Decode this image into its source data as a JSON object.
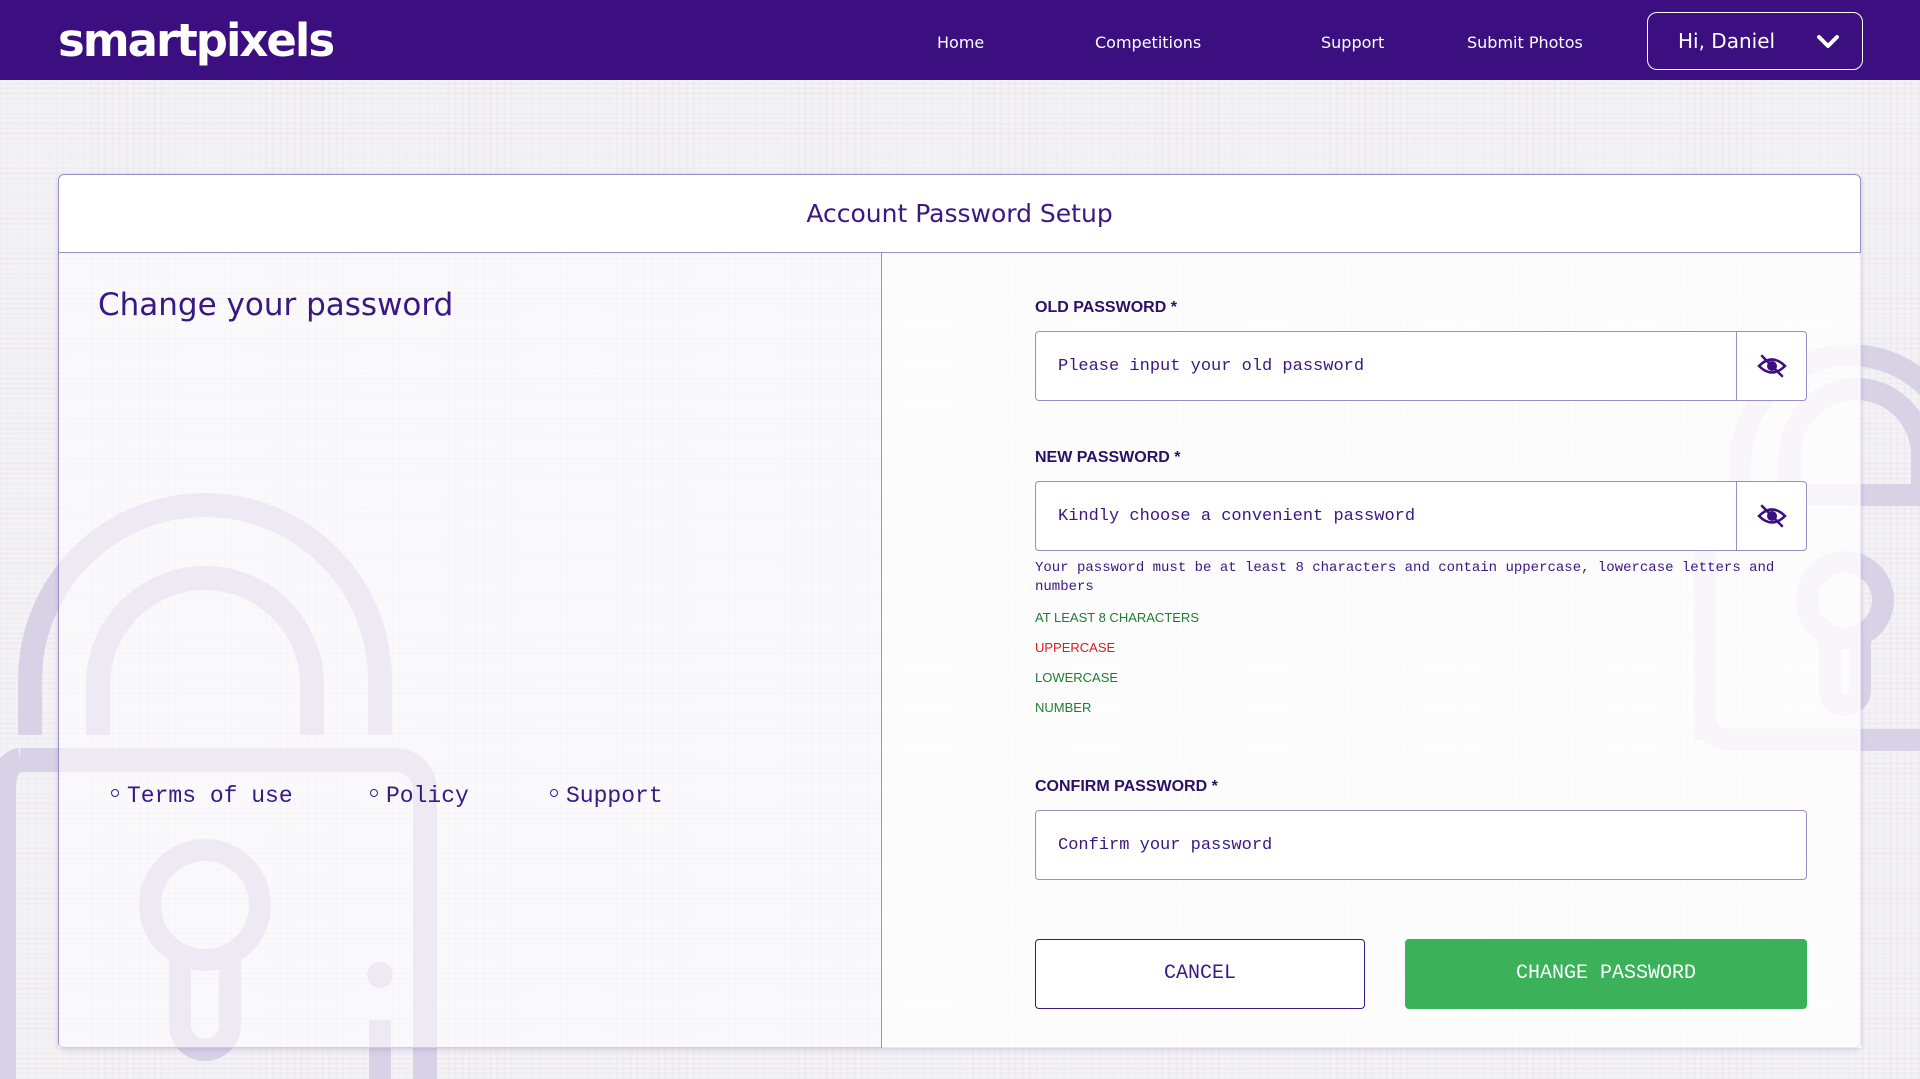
{
  "brand": {
    "logo": "smartpixels"
  },
  "nav": {
    "home": "Home",
    "competitions": "Competitions",
    "support": "Support",
    "submit_photos": "Submit Photos"
  },
  "user_menu": {
    "greeting": "Hi, Daniel"
  },
  "card": {
    "title": "Account Password Setup"
  },
  "left": {
    "title": "Change your password",
    "links": {
      "terms": "Terms of use",
      "policy": "Policy",
      "support": "Support"
    }
  },
  "form": {
    "old_password": {
      "label": "OLD PASSWORD *",
      "placeholder": "Please input your old password",
      "value": ""
    },
    "new_password": {
      "label": "NEW PASSWORD *",
      "placeholder": "Kindly choose a convenient password",
      "value": ""
    },
    "hint": "Your password must be at least 8 characters and contain uppercase, lowercase letters and numbers",
    "rules": [
      {
        "text": "AT LEAST 8 CHARACTERS",
        "status": "met",
        "color": "#1e7d2f"
      },
      {
        "text": "UPPERCASE",
        "status": "unmet",
        "color": "#d42020"
      },
      {
        "text": "LOWERCASE",
        "status": "met",
        "color": "#1e7d2f"
      },
      {
        "text": "NUMBER",
        "status": "met",
        "color": "#1e7d2f"
      }
    ],
    "confirm_password": {
      "label": "CONFIRM PASSWORD *",
      "placeholder": "Confirm your password",
      "value": ""
    },
    "cancel_label": "CANCEL",
    "submit_label": "CHANGE PASSWORD"
  },
  "colors": {
    "brand_purple": "#3b0f80",
    "text_purple": "#3b1784",
    "success_green": "#3bb15a",
    "error_red": "#d42020"
  },
  "icons": {
    "eye_toggle": "eye-slash-icon",
    "user_menu": "chevron-down-icon",
    "background": "padlock-icon"
  }
}
